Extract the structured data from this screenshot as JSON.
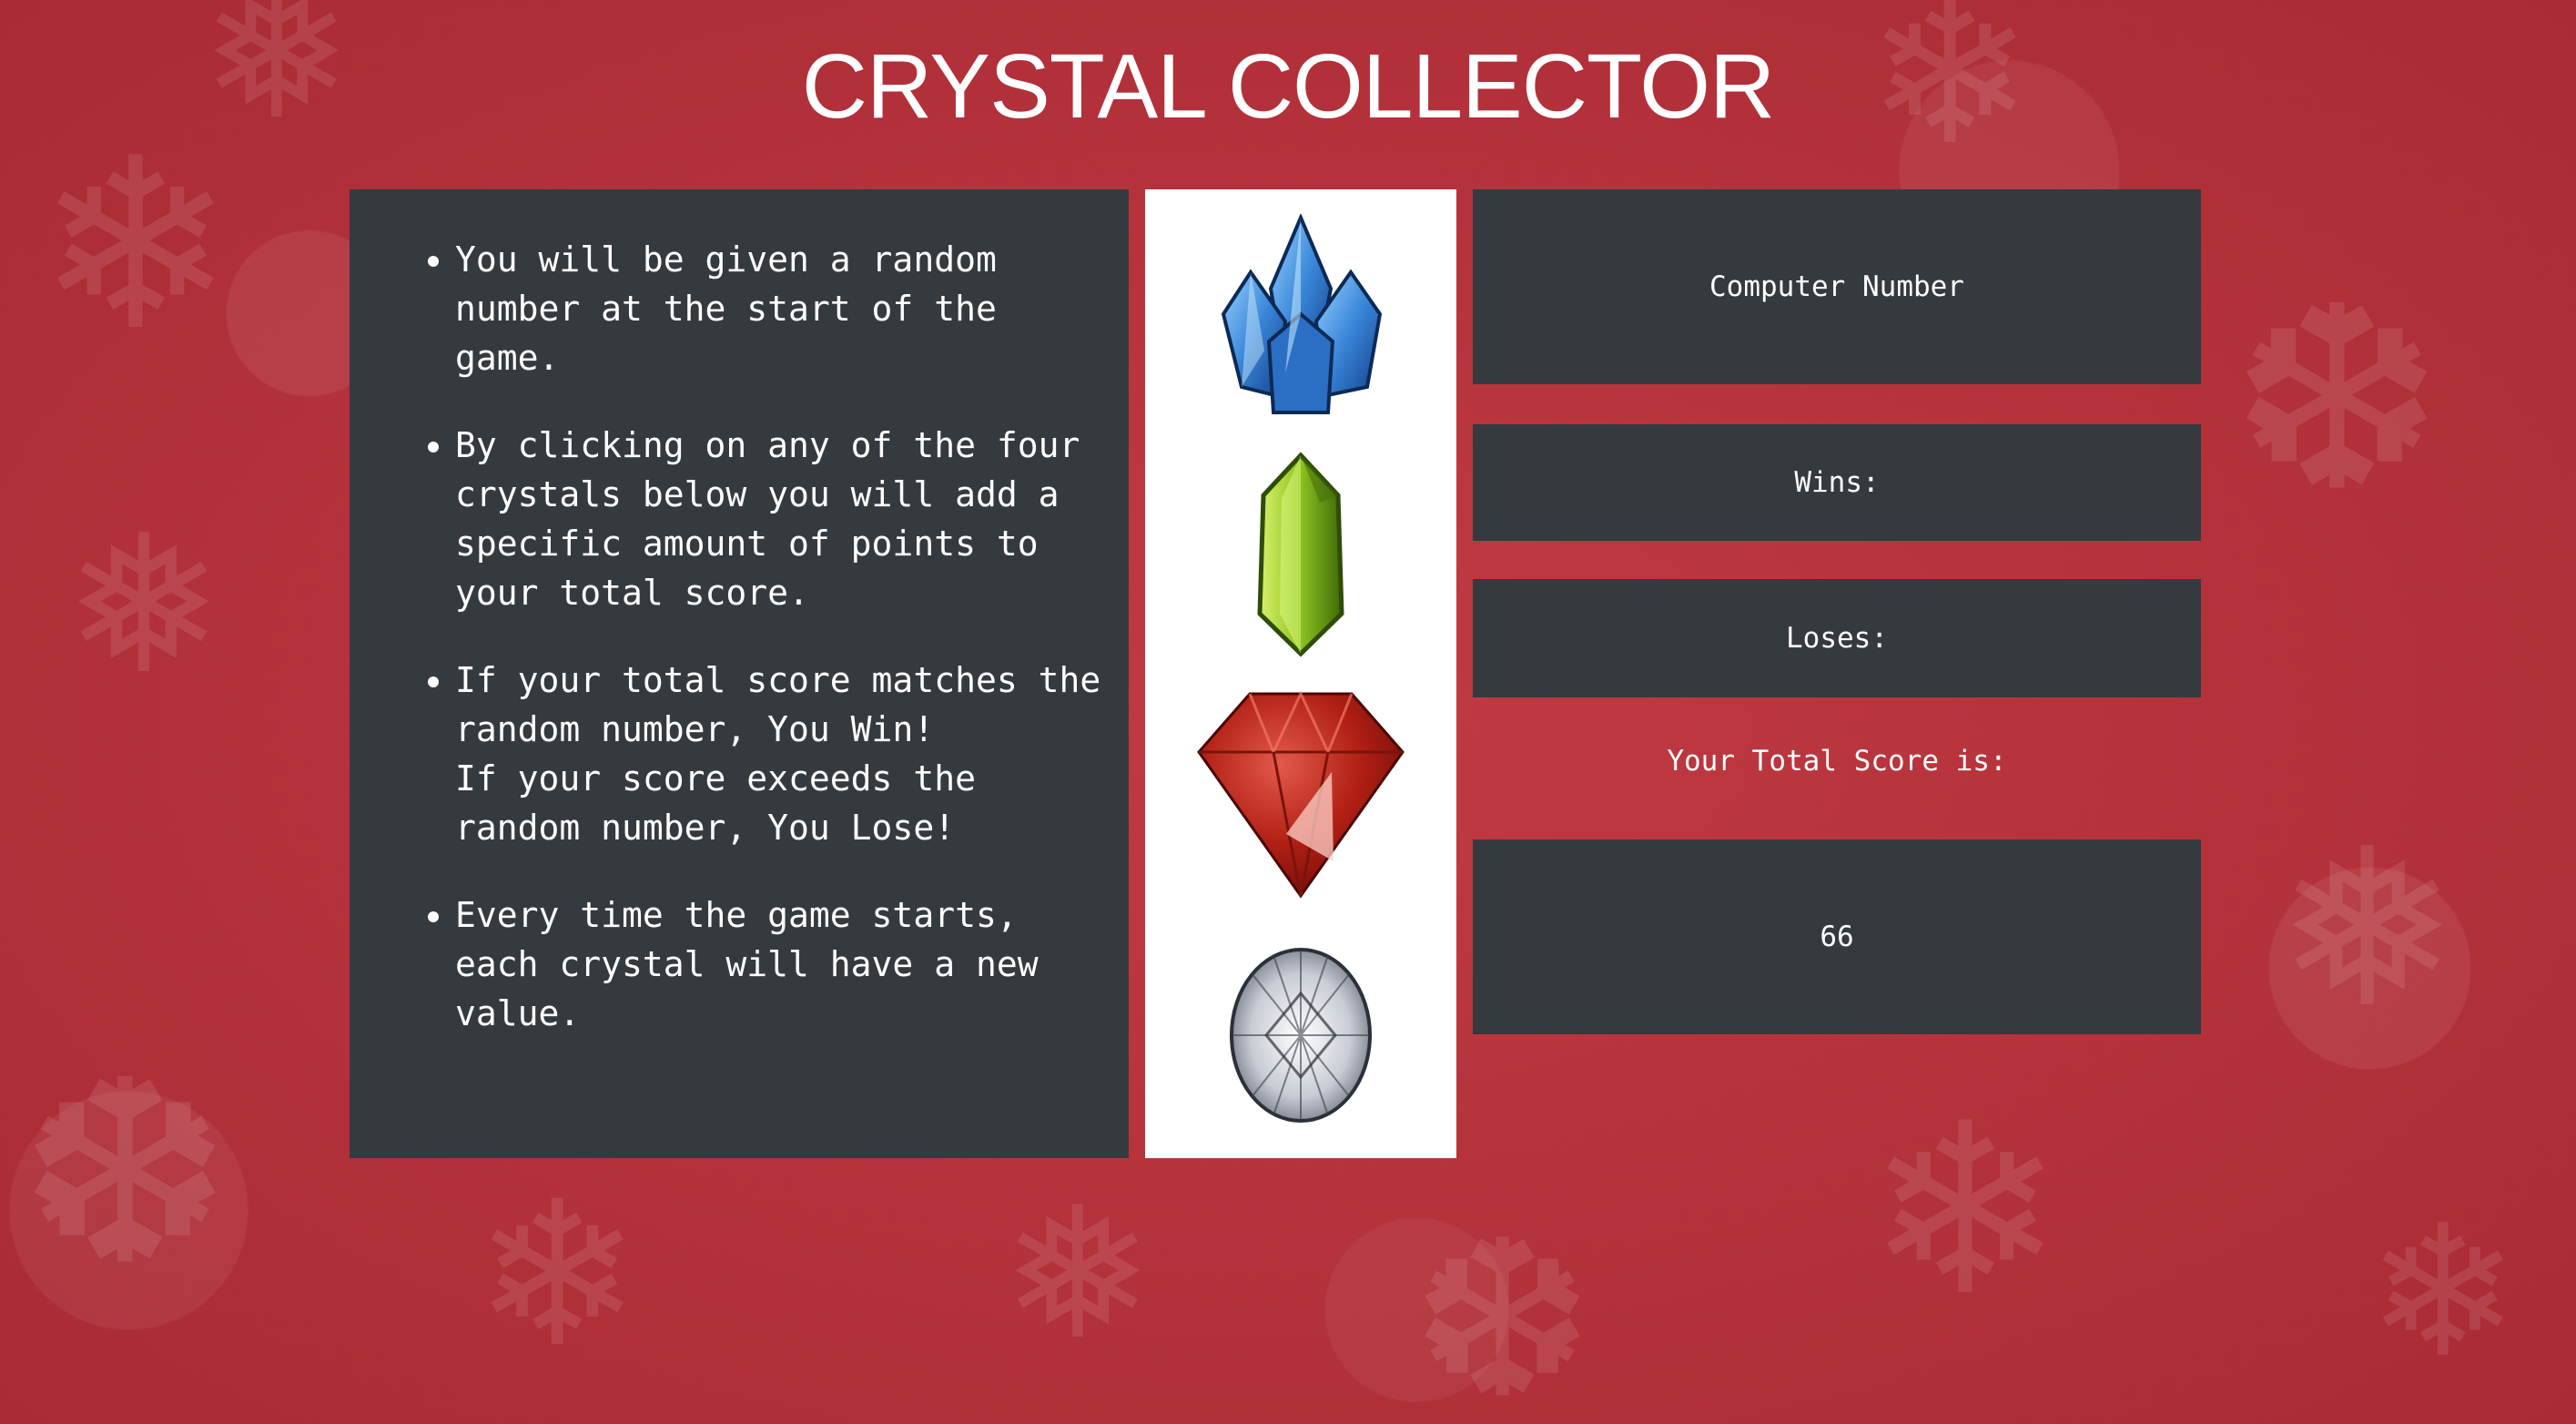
{
  "title": "CRYSTAL COLLECTOR",
  "instructions": [
    [
      "You will be given a random number at the start of the game."
    ],
    [
      "By clicking on any of the four crystals below you will add a specific amount of points to your total score."
    ],
    [
      "If your total score matches the random number, You Win!",
      "If your score exceeds the random number, You Lose!"
    ],
    [
      "Every time the game starts, each crystal will have a new value."
    ]
  ],
  "crystals": [
    {
      "name": "blue-crystal-icon",
      "color": "#3a86d9"
    },
    {
      "name": "green-crystal-icon",
      "color": "#8cc21f"
    },
    {
      "name": "red-crystal-icon",
      "color": "#b01e14"
    },
    {
      "name": "diamond-icon",
      "color": "#c8ccd4"
    }
  ],
  "stats": {
    "computer_number_label": "Computer Number",
    "wins_label": "Wins:",
    "loses_label": "Loses:",
    "total_score_label": "Your Total Score is:",
    "total_score_value": "66"
  },
  "colors": {
    "background": "#b8313a",
    "panel": "#353a3f",
    "text": "#ffffff"
  }
}
